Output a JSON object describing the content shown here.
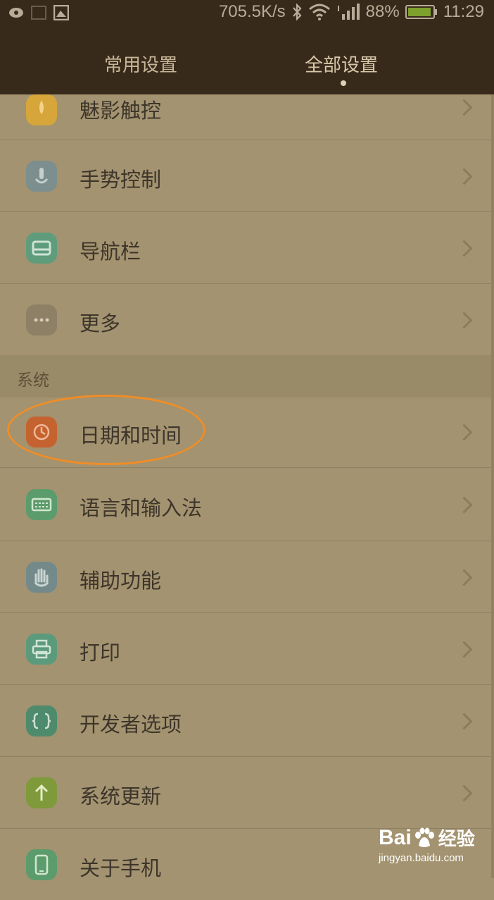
{
  "status_bar": {
    "speed": "705.5K/s",
    "battery": "88%",
    "time": "11:29",
    "icons": [
      "eye-icon",
      "sim-icon",
      "image-icon",
      "bluetooth-icon",
      "wifi-icon",
      "signal-icon",
      "battery-icon"
    ]
  },
  "tabs": [
    {
      "label": "常用设置",
      "active": false
    },
    {
      "label": "全部设置",
      "active": true
    }
  ],
  "settings": {
    "items_top": [
      {
        "label": "魅影触控",
        "icon": "phantom-touch-icon",
        "color": "#d6a63a"
      },
      {
        "label": "手势控制",
        "icon": "gesture-icon",
        "color": "#7c8e8e"
      },
      {
        "label": "导航栏",
        "icon": "navbar-icon",
        "color": "#5e9c7c"
      },
      {
        "label": "更多",
        "icon": "more-icon",
        "color": "#8e8066"
      }
    ],
    "section_system": "系统",
    "items_system": [
      {
        "label": "日期和时间",
        "icon": "clock-icon",
        "color": "#c4632f"
      },
      {
        "label": "语言和输入法",
        "icon": "keyboard-icon",
        "color": "#5c9c6c"
      },
      {
        "label": "辅助功能",
        "icon": "hand-icon",
        "color": "#748a8a"
      },
      {
        "label": "打印",
        "icon": "printer-icon",
        "color": "#5c9a7c"
      },
      {
        "label": "开发者选项",
        "icon": "developer-icon",
        "color": "#4e8a6c"
      },
      {
        "label": "系统更新",
        "icon": "update-icon",
        "color": "#7e9a3a"
      },
      {
        "label": "关于手机",
        "icon": "phone-icon",
        "color": "#5c9c6c"
      }
    ]
  },
  "watermark": {
    "brand": "Bai",
    "brand2": "经验",
    "url": "jingyan.baidu.com"
  }
}
